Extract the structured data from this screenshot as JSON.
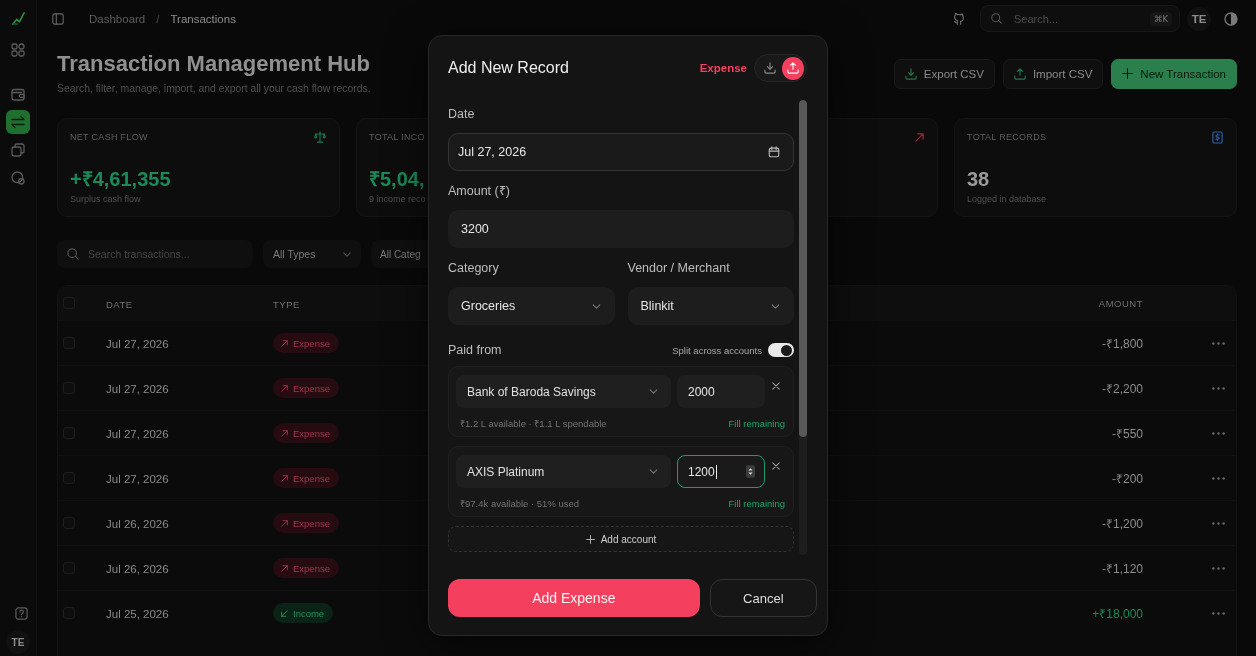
{
  "sidebar": {
    "items": [
      {
        "selected": false
      },
      {
        "selected": false
      },
      {
        "selected": true
      },
      {
        "selected": false
      },
      {
        "selected": false
      }
    ],
    "user_initials": "TE"
  },
  "header": {
    "breadcrumb": [
      "Dashboard",
      "Transactions"
    ],
    "breadcrumb_separator": "/",
    "search": {
      "placeholder": "Search...",
      "shortcut": "⌘K"
    },
    "user_initials": "TE"
  },
  "page": {
    "title": "Transaction Management Hub",
    "subtitle": "Search, filter, manage, import, and export all your cash flow records.",
    "actions": [
      {
        "kind": "export",
        "label": "Export CSV"
      },
      {
        "kind": "import",
        "label": "Import CSV"
      },
      {
        "kind": "primary",
        "label": "New Transaction"
      }
    ]
  },
  "stats": [
    {
      "kind": "net",
      "label": "NET CASH FLOW",
      "value": "+₹4,61,355",
      "note": "Surplus cash flow"
    },
    {
      "kind": "income",
      "label": "TOTAL INCO",
      "value": "₹5,04,",
      "note": "9 income reco"
    },
    {
      "kind": "expense"
    },
    {
      "kind": "count",
      "label": "TOTAL RECORDS",
      "value": "38",
      "note": "Logged in database"
    }
  ],
  "filters": {
    "search": {
      "placeholder": "Search transactions..."
    },
    "selects": [
      "All Types",
      "All Categ"
    ]
  },
  "table": {
    "all_checked": false,
    "columns": [
      "DATE",
      "TYPE",
      "AMOUNT"
    ],
    "rows": [
      {
        "checked": false,
        "date": "Jul 27, 2026",
        "kind": "expense",
        "type": "Expense",
        "amount": "-₹1,800"
      },
      {
        "checked": false,
        "date": "Jul 27, 2026",
        "kind": "expense",
        "type": "Expense",
        "amount": "-₹2,200"
      },
      {
        "checked": false,
        "date": "Jul 27, 2026",
        "kind": "expense",
        "type": "Expense",
        "amount": "-₹550"
      },
      {
        "checked": false,
        "date": "Jul 27, 2026",
        "kind": "expense",
        "type": "Expense",
        "amount": "-₹200"
      },
      {
        "checked": false,
        "date": "Jul 26, 2026",
        "kind": "expense",
        "type": "Expense",
        "amount": "-₹1,200"
      },
      {
        "checked": false,
        "date": "Jul 26, 2026",
        "kind": "expense",
        "type": "Expense",
        "amount": "-₹1,120"
      },
      {
        "checked": false,
        "date": "Jul 25, 2026",
        "kind": "income",
        "type": "Income",
        "amount": "+₹18,000"
      }
    ]
  },
  "modal": {
    "title": "Add New Record",
    "type_label": "Expense",
    "type_options": [
      {
        "kind": "income",
        "selected": false
      },
      {
        "kind": "expense",
        "selected": true
      }
    ],
    "date": {
      "label": "Date",
      "value": "Jul 27, 2026"
    },
    "amount": {
      "label": "Amount (₹)",
      "value": "3200"
    },
    "category": {
      "label": "Category",
      "value": "Groceries"
    },
    "vendor": {
      "label": "Vendor / Merchant",
      "value": "Blinkit"
    },
    "paid_from": {
      "label": "Paid from",
      "split_label": "Split across accounts",
      "split_on": true,
      "accounts": [
        {
          "account": "Bank of Baroda Savings",
          "amount": "2000",
          "focused": false,
          "info": "₹1.2 L available · ₹1.1 L spendable",
          "fill_label": "Fill remaining"
        },
        {
          "account": "AXIS Platinum",
          "amount": "1200",
          "focused": true,
          "info": "₹97.4k available · 51% used",
          "fill_label": "Fill remaining"
        }
      ],
      "add_label": "Add account"
    },
    "submit_label": "Add Expense",
    "cancel_label": "Cancel"
  }
}
